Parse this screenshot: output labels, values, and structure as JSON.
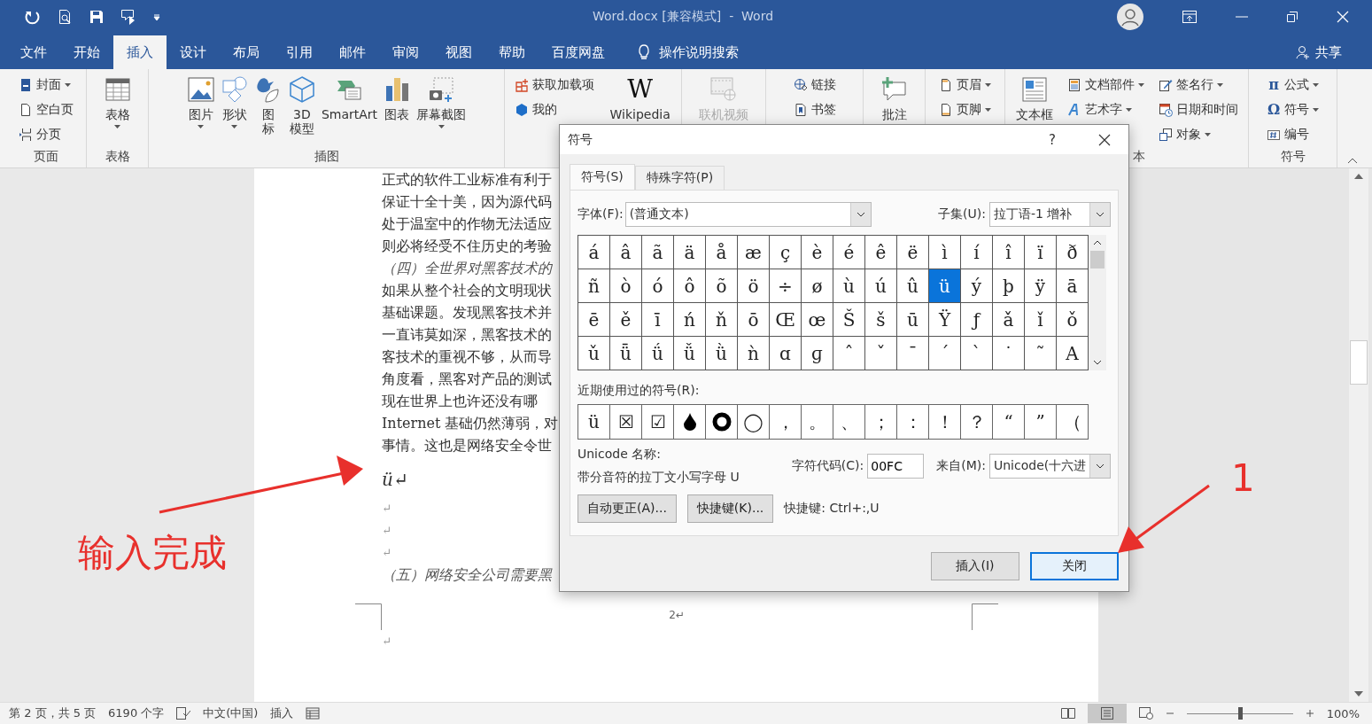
{
  "title_bar": {
    "title": "Word.docx [兼容模式]  -  Word"
  },
  "menu_tabs": [
    {
      "label": "文件",
      "selected": false
    },
    {
      "label": "开始",
      "selected": false
    },
    {
      "label": "插入",
      "selected": true
    },
    {
      "label": "设计",
      "selected": false
    },
    {
      "label": "布局",
      "selected": false
    },
    {
      "label": "引用",
      "selected": false
    },
    {
      "label": "邮件",
      "selected": false
    },
    {
      "label": "审阅",
      "selected": false
    },
    {
      "label": "视图",
      "selected": false
    },
    {
      "label": "帮助",
      "selected": false
    },
    {
      "label": "百度网盘",
      "selected": false
    }
  ],
  "tell_me": "操作说明搜索",
  "share": "共享",
  "ribbon": {
    "groups": [
      {
        "label": "页面",
        "columns": [
          {
            "kind": "small",
            "items": [
              {
                "label": "封面",
                "kind": "cover",
                "dropdown": true,
                "disabled": false
              },
              {
                "label": "空白页",
                "kind": "blank",
                "dropdown": false,
                "disabled": false
              },
              {
                "label": "分页",
                "kind": "break",
                "dropdown": false,
                "disabled": false
              }
            ]
          }
        ]
      },
      {
        "label": "表格",
        "columns": [
          {
            "kind": "large",
            "items": [
              {
                "label": "表格",
                "kind": "table",
                "dropdown": true,
                "disabled": false
              }
            ]
          }
        ]
      },
      {
        "label": "插图",
        "columns": [
          {
            "kind": "large",
            "items": [
              {
                "label": "图片",
                "kind": "picture",
                "dropdown": true,
                "disabled": false
              },
              {
                "label": "形状",
                "kind": "shapes",
                "dropdown": true,
                "disabled": false
              },
              {
                "lines": [
                  "图",
                  "标"
                ],
                "kind": "icons",
                "dropdown": false,
                "disabled": false
              },
              {
                "lines": [
                  "3D",
                  "模型"
                ],
                "kind": "model",
                "dropdown": false,
                "disabled": false
              },
              {
                "label": "SmartArt",
                "kind": "smartart",
                "dropdown": false,
                "disabled": false
              },
              {
                "label": "图表",
                "kind": "chart",
                "dropdown": false,
                "disabled": false
              },
              {
                "label": "屏幕截图",
                "kind": "screenshot",
                "dropdown": true,
                "disabled": false
              }
            ]
          }
        ]
      },
      {
        "columns": [
          {
            "kind": "small",
            "items": [
              {
                "label": "获取加载项",
                "kind": "getaddins",
                "dropdown": false,
                "disabled": false
              },
              {
                "label": "我的",
                "kind": "myaddins",
                "dropdown": false,
                "disabled": false
              }
            ]
          },
          {
            "kind": "large",
            "items": [
              {
                "label": "Wikipedia",
                "glyph": "W",
                "dropdown": false,
                "disabled": false
              }
            ]
          }
        ]
      },
      {
        "columns": [
          {
            "kind": "large",
            "items": [
              {
                "label": "联机视频",
                "kind": "video",
                "disabled": true
              }
            ]
          }
        ]
      },
      {
        "columns": [
          {
            "kind": "small",
            "items": [
              {
                "label": "链接",
                "kind": "link",
                "dropdown": false,
                "disabled": false
              },
              {
                "label": "书签",
                "kind": "bookmark",
                "dropdown": false,
                "disabled": false
              }
            ]
          }
        ]
      },
      {
        "columns": [
          {
            "kind": "large",
            "items": [
              {
                "label": "批注",
                "kind": "comment",
                "disabled": false
              }
            ]
          }
        ]
      },
      {
        "columns": [
          {
            "kind": "small",
            "items": [
              {
                "label": "页眉",
                "kind": "header",
                "dropdown": true,
                "disabled": false
              },
              {
                "label": "页脚",
                "kind": "footer",
                "dropdown": true,
                "disabled": false
              }
            ]
          }
        ]
      },
      {
        "label": "本",
        "columns": [
          {
            "kind": "large",
            "items": [
              {
                "label": "文本框",
                "kind": "textbox",
                "disabled": false
              }
            ]
          },
          {
            "kind": "small",
            "items": [
              {
                "label": "文档部件",
                "kind": "parts",
                "dropdown": true,
                "disabled": false
              },
              {
                "label": "艺术字",
                "kind": "wordart",
                "dropdown": true,
                "disabled": false
              }
            ]
          },
          {
            "kind": "small",
            "items": [
              {
                "label": "签名行",
                "kind": "signature",
                "dropdown": true,
                "disabled": false
              },
              {
                "label": "日期和时间",
                "kind": "datetime",
                "dropdown": false,
                "disabled": false
              },
              {
                "label": "对象",
                "kind": "object",
                "dropdown": true,
                "disabled": false
              }
            ]
          }
        ]
      },
      {
        "label": "符号",
        "columns": [
          {
            "kind": "small",
            "items": [
              {
                "label": "公式",
                "glyph": "π",
                "dropdown": true,
                "disabled": false
              },
              {
                "label": "符号",
                "glyph": "Ω",
                "dropdown": true,
                "disabled": false
              },
              {
                "label": "编号",
                "kind": "number",
                "dropdown": false,
                "disabled": false
              }
            ]
          }
        ]
      }
    ]
  },
  "document": {
    "paragraphs": [
      {
        "kind": "body",
        "text": "正式的软件工业标准有利于"
      },
      {
        "kind": "body",
        "text": "保证十全十美，因为源代码"
      },
      {
        "kind": "body",
        "text": "处于温室中的作物无法适应"
      },
      {
        "kind": "body",
        "text": "则必将经受不住历史的考验"
      },
      {
        "kind": "heading",
        "text": "（四）全世界对黑客技术的"
      },
      {
        "kind": "body",
        "text": "如果从整个社会的文明现状"
      },
      {
        "kind": "body",
        "text": "基础课题。发现黑客技术并"
      },
      {
        "kind": "body",
        "text": "一直讳莫如深，黑客技术的"
      },
      {
        "kind": "body",
        "text": "客技术的重视不够，从而导"
      },
      {
        "kind": "body",
        "text": "角度看，黑客对产品的测试"
      },
      {
        "kind": "body",
        "text": "现在世界上也许还没有哪"
      },
      {
        "kind": "body",
        "text": "Internet 基础仍然薄弱，对"
      },
      {
        "kind": "body",
        "text": "事情。这也是网络安全令世"
      },
      {
        "kind": "typed",
        "text": "ü↵"
      },
      {
        "kind": "mark",
        "text": "↵"
      },
      {
        "kind": "mark",
        "text": "↵"
      },
      {
        "kind": "mark",
        "text": "↵"
      },
      {
        "kind": "heading",
        "text": "（五）网络安全公司需要黑"
      }
    ],
    "page_number": "2↵",
    "next_page_mark": "↵"
  },
  "symbol_dialog": {
    "title": "符号",
    "help": "?",
    "tabs": [
      {
        "label": "符号(S)",
        "selected": true
      },
      {
        "label": "特殊字符(P)",
        "selected": false
      }
    ],
    "font_label": "字体(F):",
    "font_value": "(普通文本)",
    "subset_label": "子集(U):",
    "subset_value": "拉丁语-1 增补",
    "grid": [
      [
        {
          "char": "á",
          "selected": false
        },
        {
          "char": "â",
          "selected": false
        },
        {
          "char": "ã",
          "selected": false
        },
        {
          "char": "ä",
          "selected": false
        },
        {
          "char": "å",
          "selected": false
        },
        {
          "char": "æ",
          "selected": false
        },
        {
          "char": "ç",
          "selected": false
        },
        {
          "char": "è",
          "selected": false
        },
        {
          "char": "é",
          "selected": false
        },
        {
          "char": "ê",
          "selected": false
        },
        {
          "char": "ë",
          "selected": false
        },
        {
          "char": "ì",
          "selected": false
        },
        {
          "char": "í",
          "selected": false
        },
        {
          "char": "î",
          "selected": false
        },
        {
          "char": "ï",
          "selected": false
        },
        {
          "char": "ð",
          "selected": false
        }
      ],
      [
        {
          "char": "ñ",
          "selected": false
        },
        {
          "char": "ò",
          "selected": false
        },
        {
          "char": "ó",
          "selected": false
        },
        {
          "char": "ô",
          "selected": false
        },
        {
          "char": "õ",
          "selected": false
        },
        {
          "char": "ö",
          "selected": false
        },
        {
          "char": "÷",
          "selected": false
        },
        {
          "char": "ø",
          "selected": false
        },
        {
          "char": "ù",
          "selected": false
        },
        {
          "char": "ú",
          "selected": false
        },
        {
          "char": "û",
          "selected": false
        },
        {
          "char": "ü",
          "selected": true
        },
        {
          "char": "ý",
          "selected": false
        },
        {
          "char": "þ",
          "selected": false
        },
        {
          "char": "ÿ",
          "selected": false
        },
        {
          "char": "ā",
          "selected": false
        }
      ],
      [
        {
          "char": "ē",
          "selected": false
        },
        {
          "char": "ě",
          "selected": false
        },
        {
          "char": "ī",
          "selected": false
        },
        {
          "char": "ń",
          "selected": false
        },
        {
          "char": "ň",
          "selected": false
        },
        {
          "char": "ō",
          "selected": false
        },
        {
          "char": "Œ",
          "selected": false
        },
        {
          "char": "œ",
          "selected": false
        },
        {
          "char": "Š",
          "selected": false
        },
        {
          "char": "š",
          "selected": false
        },
        {
          "char": "ū",
          "selected": false
        },
        {
          "char": "Ÿ",
          "selected": false
        },
        {
          "char": "ƒ",
          "selected": false
        },
        {
          "char": "ǎ",
          "selected": false
        },
        {
          "char": "ǐ",
          "selected": false
        },
        {
          "char": "ǒ",
          "selected": false
        }
      ],
      [
        {
          "char": "ǔ",
          "selected": false
        },
        {
          "char": "ǖ",
          "selected": false
        },
        {
          "char": "ǘ",
          "selected": false
        },
        {
          "char": "ǚ",
          "selected": false
        },
        {
          "char": "ǜ",
          "selected": false
        },
        {
          "char": "ǹ",
          "selected": false
        },
        {
          "char": "ɑ",
          "selected": false
        },
        {
          "char": "ɡ",
          "selected": false
        },
        {
          "char": "ˆ",
          "selected": false
        },
        {
          "char": "ˇ",
          "selected": false
        },
        {
          "char": "ˉ",
          "selected": false
        },
        {
          "char": "ˊ",
          "selected": false
        },
        {
          "char": "ˋ",
          "selected": false
        },
        {
          "char": "˙",
          "selected": false
        },
        {
          "char": "˜",
          "selected": false
        },
        {
          "char": "A",
          "selected": false
        }
      ]
    ],
    "recent_label": "近期使用过的符号(R):",
    "recent": [
      {
        "kind": "char",
        "char": "ü"
      },
      {
        "kind": "char",
        "char": "☒"
      },
      {
        "kind": "char",
        "char": "☑"
      },
      {
        "kind": "drop"
      },
      {
        "kind": "ring"
      },
      {
        "kind": "char",
        "char": "◯"
      },
      {
        "kind": "char",
        "char": "，"
      },
      {
        "kind": "char",
        "char": "。"
      },
      {
        "kind": "char",
        "char": "、"
      },
      {
        "kind": "char",
        "char": "；"
      },
      {
        "kind": "char",
        "char": "："
      },
      {
        "kind": "char",
        "char": "！"
      },
      {
        "kind": "char",
        "char": "？"
      },
      {
        "kind": "char",
        "char": "“"
      },
      {
        "kind": "char",
        "char": "”"
      },
      {
        "kind": "char",
        "char": "（"
      }
    ],
    "unicode_name_label": "Unicode 名称:",
    "unicode_name": "带分音符的拉丁文小写字母 U",
    "code_label": "字符代码(C):",
    "code_value": "00FC",
    "from_label": "来自(M):",
    "from_value": "Unicode(十六进",
    "buttons": [
      "自动更正(A)...",
      "快捷键(K)..."
    ],
    "shortcut": "快捷键: Ctrl+:,U",
    "insert": "插入(I)",
    "close": "关闭"
  },
  "status_bar": {
    "left": [
      "第 2 页，共 5 页",
      "6190 个字",
      "中文(中国)",
      "插入"
    ],
    "zoom": {
      "level": 0.5,
      "label": "100%"
    }
  },
  "annotation_label": "输入完成",
  "annotation_number": "1"
}
